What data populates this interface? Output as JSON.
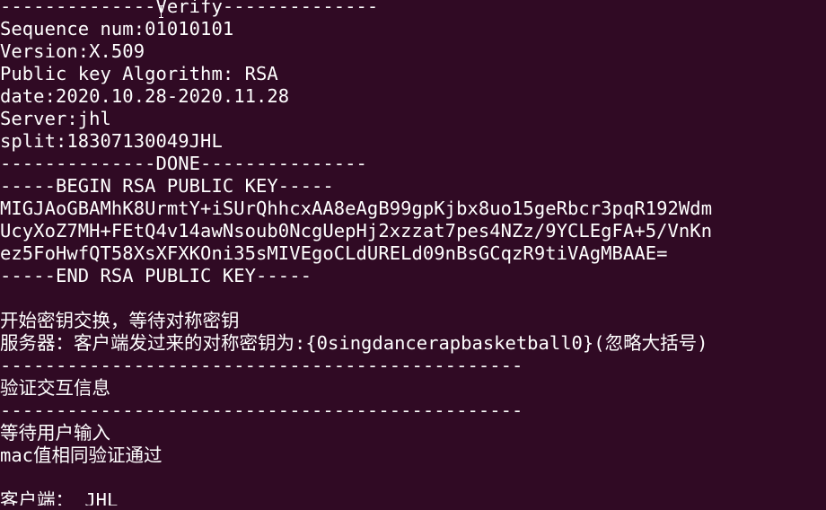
{
  "terminal": {
    "background": "#300a24",
    "foreground": "#ffffff",
    "lines": [
      "--------------Verify--------------",
      "Sequence num:01010101",
      "Version:X.509",
      "Public key Algorithm: RSA",
      "date:2020.10.28-2020.11.28",
      "Server:jhl",
      "split:18307130049JHL",
      "--------------DONE---------------",
      "-----BEGIN RSA PUBLIC KEY-----",
      "MIGJAoGBAMhK8UrmtY+iSUrQhhcxAA8eAgB99gpKjbx8uo15geRbcr3pqR192Wdm",
      "UcyXoZ7MH+FEtQ4v14awNsoub0NcgUepHj2xzzat7pes4NZz/9YCLEgFA+5/VnKn",
      "ez5FoHwfQT58XsXFXKOni35sMIVEgoCLdURELd09nBsGCqzR9tiVAgMBAAE=",
      "-----END RSA PUBLIC KEY-----",
      "",
      "开始密钥交换，等待对称密钥",
      "服务器：客户端发过来的对称密钥为:{0singdancerapbasketball0}(忽略大括号)",
      "-----------------------------------------------",
      "验证交互信息",
      "-----------------------------------------------",
      "等待用户输入",
      "mac值相同验证通过",
      "",
      "客户端： JHL"
    ]
  }
}
